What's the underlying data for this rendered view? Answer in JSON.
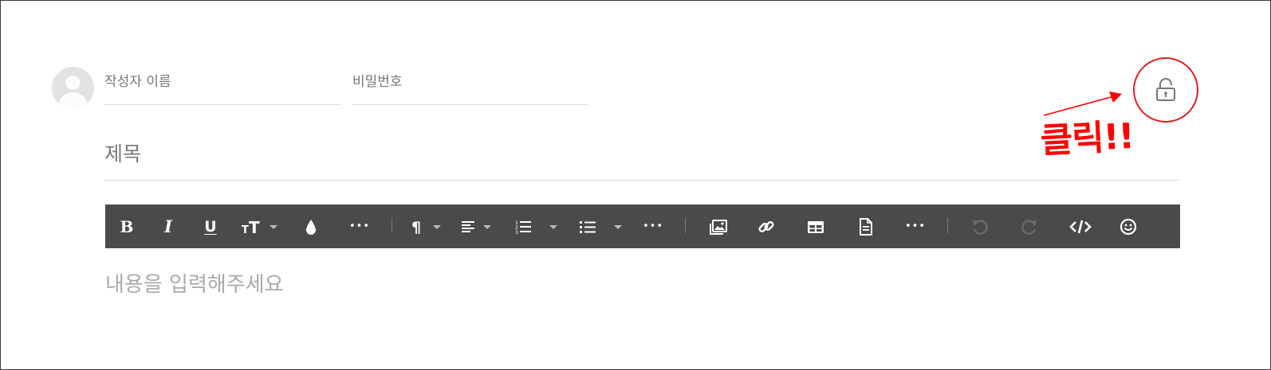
{
  "form": {
    "author_placeholder": "작성자 이름",
    "password_placeholder": "비밀번호",
    "title_placeholder": "제목",
    "content_placeholder": "내용을 입력해주세요"
  },
  "toolbar": {
    "buttons": [
      {
        "name": "bold",
        "icon": "bold-icon",
        "label": "B"
      },
      {
        "name": "italic",
        "icon": "italic-icon",
        "label": "I"
      },
      {
        "name": "underline",
        "icon": "underline-icon",
        "label": "U"
      },
      {
        "name": "font-size",
        "icon": "font-size-icon",
        "dropdown": true
      },
      {
        "name": "color",
        "icon": "drop-icon"
      },
      {
        "name": "more-text",
        "icon": "ellipsis-icon"
      },
      {
        "name": "paragraph",
        "icon": "pilcrow-icon",
        "label": "¶",
        "dropdown": true
      },
      {
        "name": "align",
        "icon": "align-left-icon",
        "dropdown": true
      },
      {
        "name": "ordered-list",
        "icon": "ordered-list-icon",
        "dropdown": true
      },
      {
        "name": "unordered-list",
        "icon": "unordered-list-icon",
        "dropdown": true
      },
      {
        "name": "more-paragraph",
        "icon": "ellipsis-icon"
      },
      {
        "name": "image",
        "icon": "image-icon"
      },
      {
        "name": "link",
        "icon": "link-icon"
      },
      {
        "name": "table",
        "icon": "table-icon"
      },
      {
        "name": "file",
        "icon": "file-icon"
      },
      {
        "name": "more-rich",
        "icon": "ellipsis-icon"
      },
      {
        "name": "undo",
        "icon": "undo-icon",
        "disabled": true
      },
      {
        "name": "redo",
        "icon": "redo-icon",
        "disabled": true
      },
      {
        "name": "code-view",
        "icon": "code-icon"
      },
      {
        "name": "emoticon",
        "icon": "smiley-icon"
      }
    ],
    "more_label": "•••"
  },
  "lock": {
    "icon": "unlock-icon"
  },
  "annotation": {
    "text": "클릭!!",
    "color": "#ff0000"
  },
  "colors": {
    "toolbar_bg": "#4a4a4a",
    "annotation": "#e02020"
  }
}
